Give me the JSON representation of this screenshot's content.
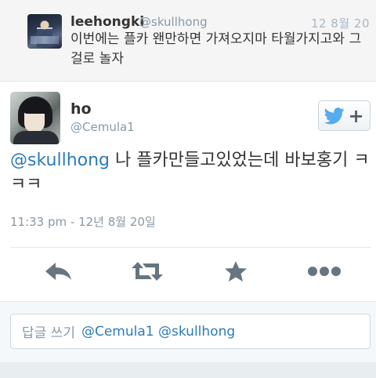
{
  "in_reply_to": {
    "name": "leehongki",
    "handle": "@skullhong",
    "time": "12 8월 20",
    "text": "이번에는 플카 왠만하면 가져오지마 타월가지고와 그걸로 놀자"
  },
  "tweet": {
    "name": "ho",
    "handle": "@Cemula1",
    "mention": "@skullhong",
    "text": " 나 플카만들고있었는데 바보홍기 ㅋㅋㅋ",
    "time": "11:33 pm - 12년 8월 20일"
  },
  "follow_button": {
    "icon": "twitter-bird-icon",
    "symbol": "+"
  },
  "actions": [
    {
      "name": "reply",
      "icon": "reply-arrow-icon"
    },
    {
      "name": "retweet",
      "icon": "retweet-icon"
    },
    {
      "name": "favorite",
      "icon": "star-icon"
    },
    {
      "name": "more",
      "icon": "ellipsis-icon"
    }
  ],
  "reply_box": {
    "placeholder": "답글 쓰기",
    "prefill": "@Cemula1 @skullhong"
  },
  "colors": {
    "link": "#2b7bb9",
    "twitter_blue": "#55acee",
    "icon_gray": "#66757f",
    "muted_text": "#8899a6"
  }
}
